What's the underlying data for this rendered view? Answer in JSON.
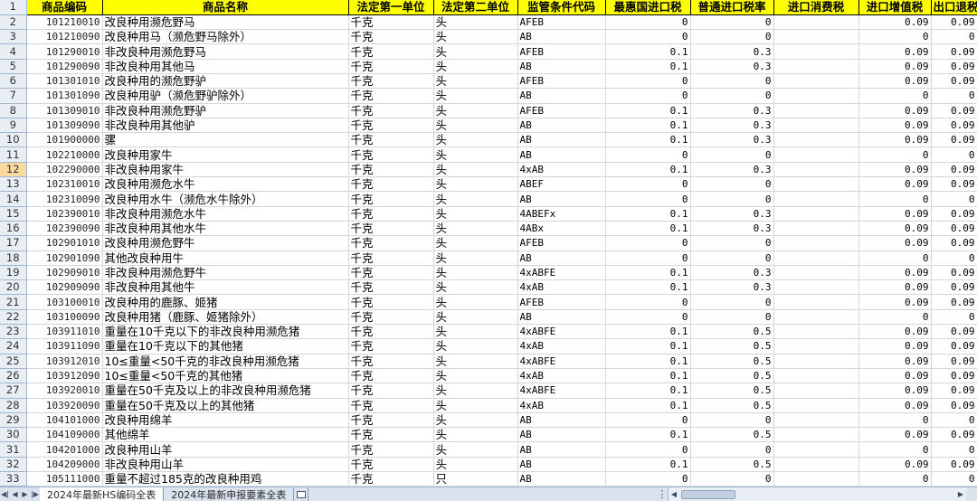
{
  "active_row": 12,
  "headers": [
    "商品编码",
    "商品名称",
    "法定第一单位",
    "法定第二单位",
    "监管条件代码",
    "最惠国进口税",
    "普通进口税率",
    "进口消费税",
    "进口增值税",
    "出口退税"
  ],
  "row_numbers": [
    "1",
    "2",
    "3",
    "4",
    "5",
    "6",
    "7",
    "8",
    "9",
    "10",
    "11",
    "12",
    "13",
    "14",
    "15",
    "16",
    "17",
    "18",
    "19",
    "20",
    "21",
    "22",
    "23",
    "24",
    "25",
    "26",
    "27",
    "28",
    "29",
    "30",
    "31",
    "32",
    "33"
  ],
  "rows": [
    [
      "101210010",
      "改良种用濒危野马",
      "千克",
      "头",
      "AFEB",
      "0",
      "0",
      "",
      "0.09",
      "0.09"
    ],
    [
      "101210090",
      "改良种用马（濒危野马除外）",
      "千克",
      "头",
      "AB",
      "0",
      "0",
      "",
      "0",
      "0"
    ],
    [
      "101290010",
      "非改良种用濒危野马",
      "千克",
      "头",
      "AFEB",
      "0.1",
      "0.3",
      "",
      "0.09",
      "0.09"
    ],
    [
      "101290090",
      "非改良种用其他马",
      "千克",
      "头",
      "AB",
      "0.1",
      "0.3",
      "",
      "0.09",
      "0.09"
    ],
    [
      "101301010",
      "改良种用的濒危野驴",
      "千克",
      "头",
      "AFEB",
      "0",
      "0",
      "",
      "0.09",
      "0.09"
    ],
    [
      "101301090",
      "改良种用驴（濒危野驴除外）",
      "千克",
      "头",
      "AB",
      "0",
      "0",
      "",
      "0",
      "0"
    ],
    [
      "101309010",
      "非改良种用濒危野驴",
      "千克",
      "头",
      "AFEB",
      "0.1",
      "0.3",
      "",
      "0.09",
      "0.09"
    ],
    [
      "101309090",
      "非改良种用其他驴",
      "千克",
      "头",
      "AB",
      "0.1",
      "0.3",
      "",
      "0.09",
      "0.09"
    ],
    [
      "101900000",
      "骡",
      "千克",
      "头",
      "AB",
      "0.1",
      "0.3",
      "",
      "0.09",
      "0.09"
    ],
    [
      "102210000",
      "改良种用家牛",
      "千克",
      "头",
      "AB",
      "0",
      "0",
      "",
      "0",
      "0"
    ],
    [
      "102290000",
      "非改良种用家牛",
      "千克",
      "头",
      "4xAB",
      "0.1",
      "0.3",
      "",
      "0.09",
      "0.09"
    ],
    [
      "102310010",
      "改良种用濒危水牛",
      "千克",
      "头",
      "ABEF",
      "0",
      "0",
      "",
      "0.09",
      "0.09"
    ],
    [
      "102310090",
      "改良种用水牛（濒危水牛除外）",
      "千克",
      "头",
      "AB",
      "0",
      "0",
      "",
      "0",
      "0"
    ],
    [
      "102390010",
      "非改良种用濒危水牛",
      "千克",
      "头",
      "4ABEFx",
      "0.1",
      "0.3",
      "",
      "0.09",
      "0.09"
    ],
    [
      "102390090",
      "非改良种用其他水牛",
      "千克",
      "头",
      "4ABx",
      "0.1",
      "0.3",
      "",
      "0.09",
      "0.09"
    ],
    [
      "102901010",
      "改良种用濒危野牛",
      "千克",
      "头",
      "AFEB",
      "0",
      "0",
      "",
      "0.09",
      "0.09"
    ],
    [
      "102901090",
      "其他改良种用牛",
      "千克",
      "头",
      "AB",
      "0",
      "0",
      "",
      "0",
      "0"
    ],
    [
      "102909010",
      "非改良种用濒危野牛",
      "千克",
      "头",
      "4xABFE",
      "0.1",
      "0.3",
      "",
      "0.09",
      "0.09"
    ],
    [
      "102909090",
      "非改良种用其他牛",
      "千克",
      "头",
      "4xAB",
      "0.1",
      "0.3",
      "",
      "0.09",
      "0.09"
    ],
    [
      "103100010",
      "改良种用的鹿豚、姬猪",
      "千克",
      "头",
      "AFEB",
      "0",
      "0",
      "",
      "0.09",
      "0.09"
    ],
    [
      "103100090",
      "改良种用猪（鹿豚、姬猪除外）",
      "千克",
      "头",
      "AB",
      "0",
      "0",
      "",
      "0",
      "0"
    ],
    [
      "103911010",
      "重量在10千克以下的非改良种用濒危猪",
      "千克",
      "头",
      "4xABFE",
      "0.1",
      "0.5",
      "",
      "0.09",
      "0.09"
    ],
    [
      "103911090",
      "重量在10千克以下的其他猪",
      "千克",
      "头",
      "4xAB",
      "0.1",
      "0.5",
      "",
      "0.09",
      "0.09"
    ],
    [
      "103912010",
      "10≤重量<50千克的非改良种用濒危猪",
      "千克",
      "头",
      "4xABFE",
      "0.1",
      "0.5",
      "",
      "0.09",
      "0.09"
    ],
    [
      "103912090",
      "10≤重量<50千克的其他猪",
      "千克",
      "头",
      "4xAB",
      "0.1",
      "0.5",
      "",
      "0.09",
      "0.09"
    ],
    [
      "103920010",
      "重量在50千克及以上的非改良种用濒危猪",
      "千克",
      "头",
      "4xABFE",
      "0.1",
      "0.5",
      "",
      "0.09",
      "0.09"
    ],
    [
      "103920090",
      "重量在50千克及以上的其他猪",
      "千克",
      "头",
      "4xAB",
      "0.1",
      "0.5",
      "",
      "0.09",
      "0.09"
    ],
    [
      "104101000",
      "改良种用绵羊",
      "千克",
      "头",
      "AB",
      "0",
      "0",
      "",
      "0",
      "0"
    ],
    [
      "104109000",
      "其他绵羊",
      "千克",
      "头",
      "AB",
      "0.1",
      "0.5",
      "",
      "0.09",
      "0.09"
    ],
    [
      "104201000",
      "改良种用山羊",
      "千克",
      "头",
      "AB",
      "0",
      "0",
      "",
      "0",
      "0"
    ],
    [
      "104209000",
      "非改良种用山羊",
      "千克",
      "头",
      "AB",
      "0.1",
      "0.5",
      "",
      "0.09",
      "0.09"
    ],
    [
      "105111000",
      "重量不超过185克的改良种用鸡",
      "千克",
      "只",
      "AB",
      "0",
      "0",
      "",
      "0",
      "0"
    ]
  ],
  "sheet_tabs": [
    "2024年最新HS编码全表",
    "2024年最新申报要素全表"
  ],
  "active_tab": 0,
  "nav_icons": [
    "first-sheet-icon",
    "prev-sheet-icon",
    "next-sheet-icon",
    "last-sheet-icon"
  ]
}
